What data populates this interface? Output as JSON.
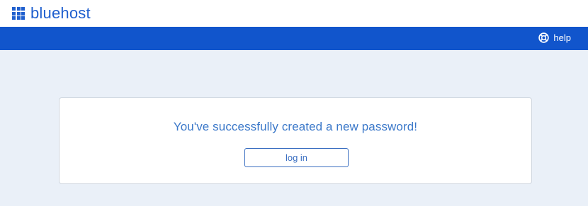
{
  "header": {
    "logo_text": "bluehost"
  },
  "nav": {
    "help_label": "help",
    "help_icon": "lifebuoy-icon"
  },
  "card": {
    "message": "You've successfully created a new password!",
    "login_label": "log in"
  },
  "colors": {
    "brand_blue": "#1f5fce",
    "nav_blue": "#1155cc",
    "page_background": "#eaf0f8",
    "message_text": "#3b78c9"
  }
}
